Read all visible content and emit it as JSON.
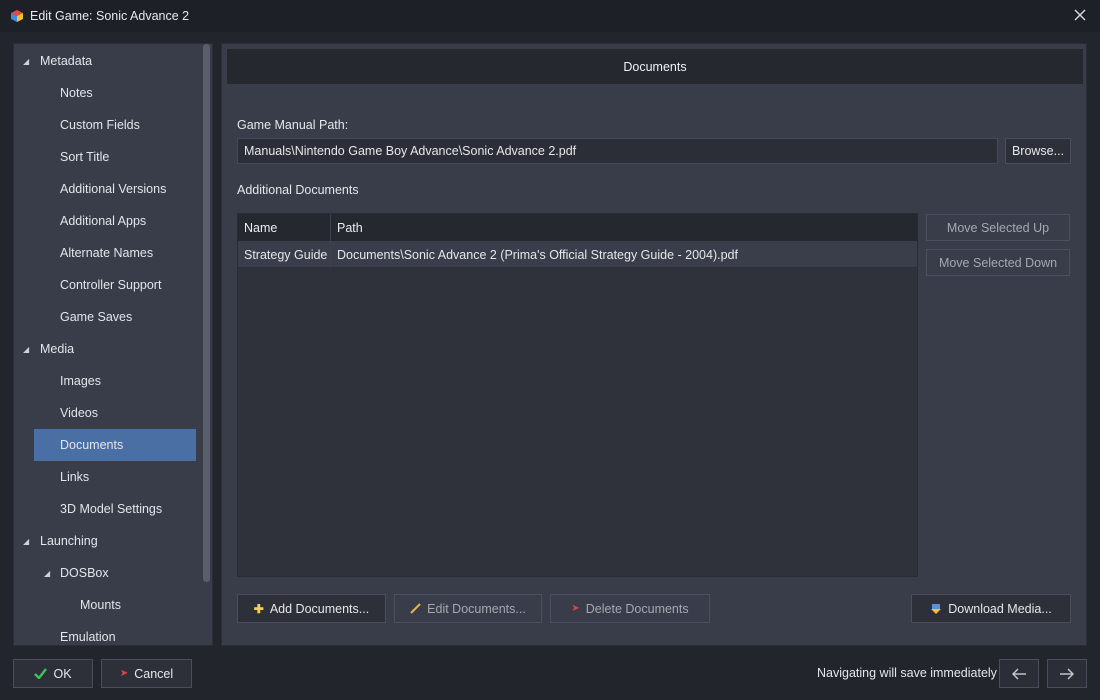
{
  "window": {
    "title": "Edit Game: Sonic Advance 2"
  },
  "sidebar": {
    "items": [
      {
        "label": "Metadata",
        "level": 0,
        "expanded": true
      },
      {
        "label": "Notes",
        "level": 1
      },
      {
        "label": "Custom Fields",
        "level": 1
      },
      {
        "label": "Sort Title",
        "level": 1
      },
      {
        "label": "Additional Versions",
        "level": 1
      },
      {
        "label": "Additional Apps",
        "level": 1
      },
      {
        "label": "Alternate Names",
        "level": 1
      },
      {
        "label": "Controller Support",
        "level": 1
      },
      {
        "label": "Game Saves",
        "level": 1
      },
      {
        "label": "Media",
        "level": 0,
        "expanded": true
      },
      {
        "label": "Images",
        "level": 1
      },
      {
        "label": "Videos",
        "level": 1
      },
      {
        "label": "Documents",
        "level": 1,
        "selected": true
      },
      {
        "label": "Links",
        "level": 1
      },
      {
        "label": "3D Model Settings",
        "level": 1
      },
      {
        "label": "Launching",
        "level": 0,
        "expanded": true
      },
      {
        "label": "DOSBox",
        "level": 1,
        "expanded": true
      },
      {
        "label": "Mounts",
        "level": 2
      },
      {
        "label": "Emulation",
        "level": 1
      }
    ]
  },
  "main": {
    "header": "Documents",
    "manual_path_label": "Game Manual Path:",
    "manual_path_value": "Manuals\\Nintendo Game Boy Advance\\Sonic Advance 2.pdf",
    "browse_label": "Browse...",
    "additional_docs_label": "Additional Documents",
    "table": {
      "columns": [
        "Name",
        "Path"
      ],
      "rows": [
        {
          "name": "Strategy Guide",
          "path": "Documents\\Sonic Advance 2 (Prima's Official Strategy Guide - 2004).pdf"
        }
      ]
    },
    "move_up_label": "Move Selected Up",
    "move_down_label": "Move Selected Down",
    "add_docs_label": "Add Documents...",
    "edit_docs_label": "Edit Documents...",
    "delete_docs_label": "Delete Documents",
    "download_media_label": "Download Media..."
  },
  "footer": {
    "ok_label": "OK",
    "cancel_label": "Cancel",
    "nav_note": "Navigating will save immediately"
  },
  "colors": {
    "selection": "#4a6fa5",
    "panel": "#393c49",
    "background": "#23252d"
  }
}
